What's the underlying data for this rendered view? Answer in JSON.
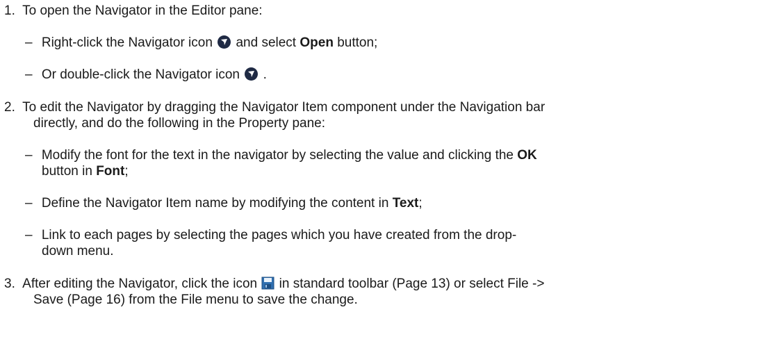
{
  "steps": [
    {
      "number": "1.",
      "text": "To open the Navigator in the Editor pane:",
      "subs": [
        {
          "a": "Right-click the Navigator icon",
          "b": "and select",
          "c": "Open",
          "d": "button;"
        },
        {
          "a": "Or double-click the Navigator icon",
          "b": "."
        }
      ]
    },
    {
      "number": "2.",
      "line1": "To edit the Navigator by dragging the Navigator Item component under the Navigation bar",
      "line2": "directly, and do the following in the Property pane:",
      "subs": [
        {
          "a": "Modify the font for the text in the navigator by selecting the value and clicking the",
          "b": "OK",
          "c": "button in",
          "d": "Font",
          "e": ";"
        },
        {
          "a": "Define the Navigator Item name by modifying the content in",
          "b": "Text",
          "c": ";"
        },
        {
          "a": "Link to each pages by selecting the pages which you have created from the drop-",
          "b": "down menu."
        }
      ]
    },
    {
      "number": "3.",
      "line1a": "After editing the Navigator, click the icon",
      "line1b": "in standard toolbar  (Page 13) or select File ->",
      "line2": "Save (Page 16) from the File menu to save the change."
    }
  ],
  "dash": "–",
  "icons": {
    "navigator": "navigator-icon",
    "save": "floppy-disk-save-icon",
    "navigator_color": "#1f2a44"
  }
}
